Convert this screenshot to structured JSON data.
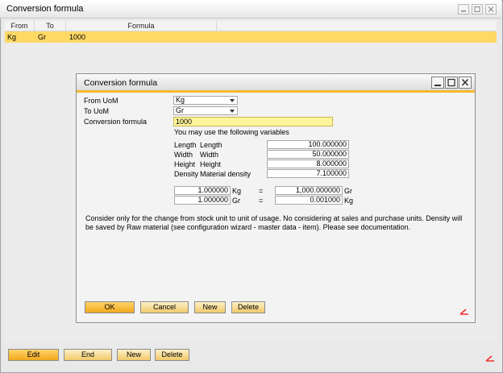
{
  "outer": {
    "title": "Conversion formula",
    "grid": {
      "columns": [
        "From",
        "To",
        "Formula"
      ],
      "rows": [
        {
          "from": "Kg",
          "to": "Gr",
          "formula": "1000"
        }
      ]
    },
    "buttons": {
      "edit": "Edit",
      "end": "End",
      "new": "New",
      "delete": "Delete"
    }
  },
  "dialog": {
    "title": "Conversion formula",
    "from_uom": {
      "label": "From UoM",
      "value": "Kg"
    },
    "to_uom": {
      "label": "To UoM",
      "value": "Gr"
    },
    "formula": {
      "label": "Conversion formula",
      "value": "1000"
    },
    "variables_hint": "You may use the following variables",
    "variables": [
      {
        "name": "Length",
        "desc": "Length",
        "value": "100.000000"
      },
      {
        "name": "Width",
        "desc": "Width",
        "value": "50.000000"
      },
      {
        "name": "Height",
        "desc": "Height",
        "value": "8.000000"
      },
      {
        "name": "Density",
        "desc": "Material density",
        "value": "7.100000"
      }
    ],
    "conversions": [
      {
        "left_value": "1.000000",
        "left_unit": "Kg",
        "eq": "=",
        "right_value": "1,000.000000",
        "right_unit": "Gr"
      },
      {
        "left_value": "1.000000",
        "left_unit": "Gr",
        "eq": "=",
        "right_value": "0.001000",
        "right_unit": "Kg"
      }
    ],
    "note": "Consider only for the change from stock unit to unit of usage. No considering at sales and purchase units. Density will be saved by Raw material (see configuration wizard - master data - item). Please see documentation.",
    "buttons": {
      "ok": "OK",
      "cancel": "Cancel",
      "new": "New",
      "delete": "Delete"
    }
  },
  "colors": {
    "accent": "#f5b82e",
    "selected_row": "#ffd966",
    "formula_field": "#fff59d"
  }
}
